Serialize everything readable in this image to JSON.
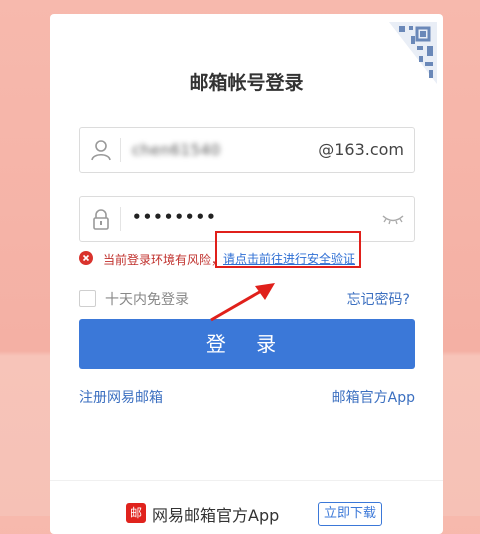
{
  "title": "邮箱帐号登录",
  "username": {
    "value": "chen61540",
    "domain": "@163.com"
  },
  "password": {
    "masked": "••••••••"
  },
  "risk": {
    "message": "当前登录环境有风险，",
    "link": "请点击前往进行安全验证"
  },
  "remember_label": "十天内免登录",
  "forgot_label": "忘记密码?",
  "login_label": "登 录",
  "links": {
    "register": "注册网易邮箱",
    "app": "邮箱官方App"
  },
  "footer": {
    "logo_char": "邮",
    "app_name": "网易邮箱官方App",
    "download": "立即下载"
  },
  "colors": {
    "accent": "#3b78d8",
    "warning": "#c0302c",
    "highlight_box": "#e0201b"
  },
  "icons": [
    "qr-code-icon",
    "user-icon",
    "lock-icon",
    "eye-closed-icon",
    "error-circle-icon",
    "red-arrow"
  ]
}
